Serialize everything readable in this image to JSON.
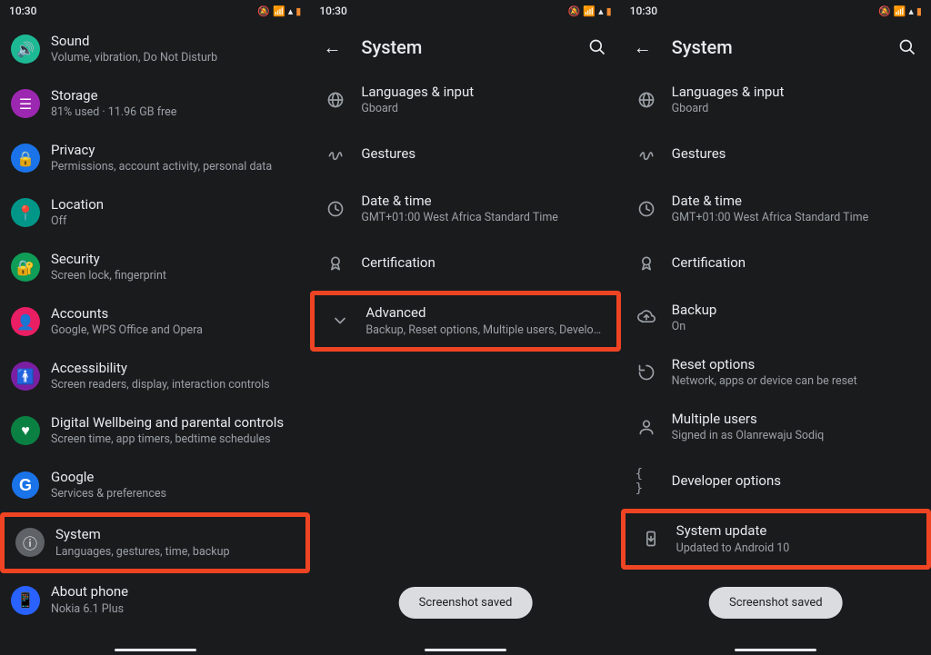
{
  "status": {
    "time": "10:30"
  },
  "phone1": {
    "items": [
      {
        "title": "Sound",
        "sub": "Volume, vibration, Do Not Disturb",
        "icon": "volume-icon",
        "color": "bg-teal"
      },
      {
        "title": "Storage",
        "sub": "81% used · 11.96 GB free",
        "icon": "storage-icon",
        "color": "bg-purple"
      },
      {
        "title": "Privacy",
        "sub": "Permissions, account activity, personal data",
        "icon": "lock-icon",
        "color": "bg-blue"
      },
      {
        "title": "Location",
        "sub": "Off",
        "icon": "location-icon",
        "color": "bg-teal2"
      },
      {
        "title": "Security",
        "sub": "Screen lock, fingerprint",
        "icon": "security-icon",
        "color": "bg-green"
      },
      {
        "title": "Accounts",
        "sub": "Google, WPS Office and Opera",
        "icon": "accounts-icon",
        "color": "bg-pink"
      },
      {
        "title": "Accessibility",
        "sub": "Screen readers, display, interaction controls",
        "icon": "accessibility-icon",
        "color": "bg-violet"
      },
      {
        "title": "Digital Wellbeing and parental controls",
        "sub": "Screen time, app timers, bedtime schedules",
        "icon": "wellbeing-icon",
        "color": "bg-green2"
      },
      {
        "title": "Google",
        "sub": "Services & preferences",
        "icon": "google-icon",
        "color": ""
      },
      {
        "title": "System",
        "sub": "Languages, gestures, time, backup",
        "icon": "info-icon",
        "color": "bg-grey",
        "highlight": true
      },
      {
        "title": "About phone",
        "sub": "Nokia 6.1 Plus",
        "icon": "phone-icon",
        "color": "bg-blue2"
      }
    ]
  },
  "phone2": {
    "title": "System",
    "items": [
      {
        "title": "Languages & input",
        "sub": "Gboard",
        "icon": "globe-icon"
      },
      {
        "title": "Gestures",
        "sub": "",
        "icon": "gesture-icon"
      },
      {
        "title": "Date & time",
        "sub": "GMT+01:00 West Africa Standard Time",
        "icon": "clock-icon"
      },
      {
        "title": "Certification",
        "sub": "",
        "icon": "cert-icon"
      },
      {
        "title": "Advanced",
        "sub": "Backup, Reset options, Multiple users, Developer o..",
        "icon": "chevron-down-icon",
        "highlight": true
      }
    ],
    "snackbar": "Screenshot saved"
  },
  "phone3": {
    "title": "System",
    "items": [
      {
        "title": "Languages & input",
        "sub": "Gboard",
        "icon": "globe-icon"
      },
      {
        "title": "Gestures",
        "sub": "",
        "icon": "gesture-icon"
      },
      {
        "title": "Date & time",
        "sub": "GMT+01:00 West Africa Standard Time",
        "icon": "clock-icon"
      },
      {
        "title": "Certification",
        "sub": "",
        "icon": "cert-icon"
      },
      {
        "title": "Backup",
        "sub": "On",
        "icon": "backup-icon"
      },
      {
        "title": "Reset options",
        "sub": "Network, apps or device can be reset",
        "icon": "reset-icon"
      },
      {
        "title": "Multiple users",
        "sub": "Signed in as Olanrewaju Sodiq",
        "icon": "users-icon"
      },
      {
        "title": "Developer options",
        "sub": "",
        "icon": "dev-icon"
      },
      {
        "title": "System update",
        "sub": "Updated to Android 10",
        "icon": "update-icon",
        "highlight": true
      }
    ],
    "snackbar": "Screenshot saved"
  }
}
